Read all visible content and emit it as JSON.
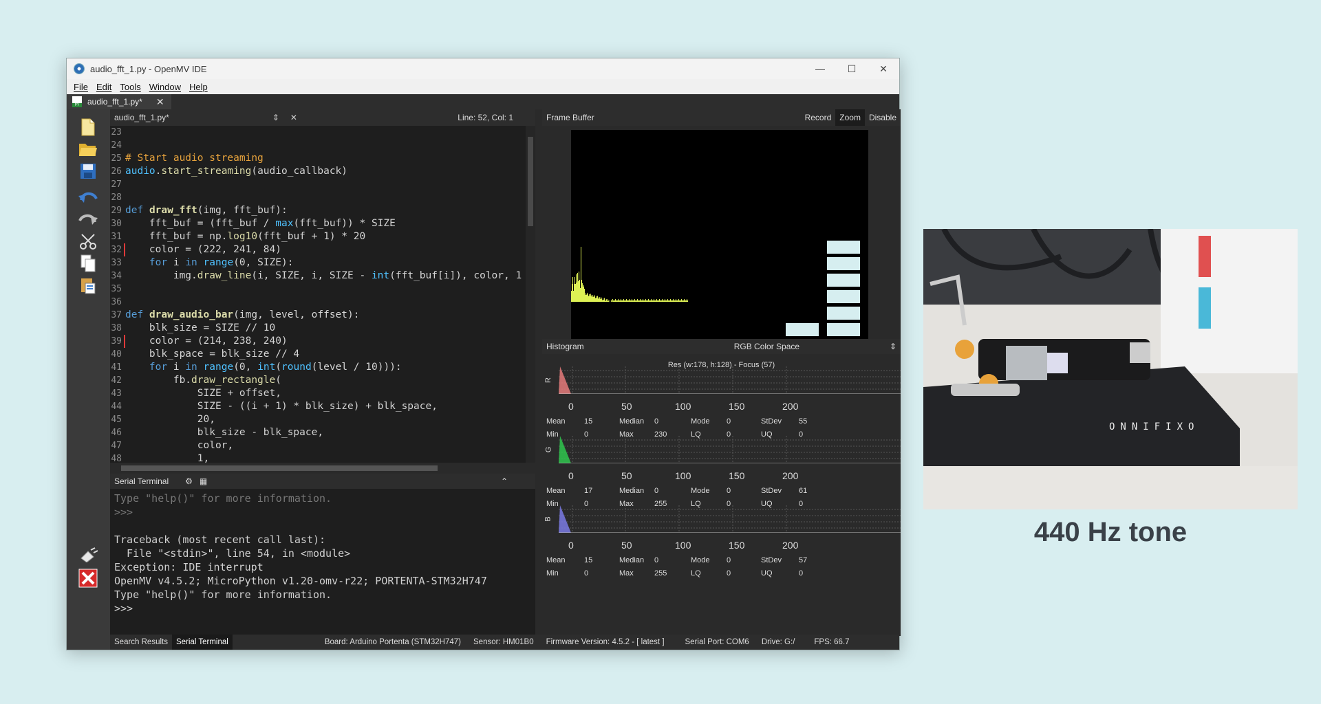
{
  "window": {
    "title": "audio_fft_1.py - OpenMV IDE"
  },
  "menu": [
    "File",
    "Edit",
    "Tools",
    "Window",
    "Help"
  ],
  "file_tab": {
    "label": "audio_fft_1.py*"
  },
  "editor": {
    "file": "audio_fft_1.py*",
    "position": "Line: 52, Col: 1",
    "lines": [
      {
        "n": "23",
        "t": ""
      },
      {
        "n": "24",
        "t": ""
      },
      {
        "n": "25",
        "t": "# Start audio streaming"
      },
      {
        "n": "26",
        "t": "audio.start_streaming(audio_callback)"
      },
      {
        "n": "27",
        "t": ""
      },
      {
        "n": "28",
        "t": ""
      },
      {
        "n": "29",
        "t": "def draw_fft(img, fft_buf):"
      },
      {
        "n": "30",
        "t": "    fft_buf = (fft_buf / max(fft_buf)) * SIZE"
      },
      {
        "n": "31",
        "t": "    fft_buf = np.log10(fft_buf + 1) * 20"
      },
      {
        "n": "32",
        "t": "    color = (222, 241, 84)"
      },
      {
        "n": "33",
        "t": "    for i in range(0, SIZE):"
      },
      {
        "n": "34",
        "t": "        img.draw_line(i, SIZE, i, SIZE - int(fft_buf[i]), color, 1"
      },
      {
        "n": "35",
        "t": ""
      },
      {
        "n": "36",
        "t": ""
      },
      {
        "n": "37",
        "t": "def draw_audio_bar(img, level, offset):"
      },
      {
        "n": "38",
        "t": "    blk_size = SIZE // 10"
      },
      {
        "n": "39",
        "t": "    color = (214, 238, 240)"
      },
      {
        "n": "40",
        "t": "    blk_space = blk_size // 4"
      },
      {
        "n": "41",
        "t": "    for i in range(0, int(round(level / 10))):"
      },
      {
        "n": "42",
        "t": "        fb.draw_rectangle("
      },
      {
        "n": "43",
        "t": "            SIZE + offset,"
      },
      {
        "n": "44",
        "t": "            SIZE - ((i + 1) * blk_size) + blk_space,"
      },
      {
        "n": "45",
        "t": "            20,"
      },
      {
        "n": "46",
        "t": "            blk_size - blk_space,"
      },
      {
        "n": "47",
        "t": "            color,"
      },
      {
        "n": "48",
        "t": "            1,"
      }
    ]
  },
  "terminal": {
    "title": "Serial Terminal",
    "lines": [
      {
        "t": "Type \"help()\" for more information.",
        "dim": true
      },
      {
        "t": ">>>",
        "dim": true
      },
      {
        "t": "",
        "dim": false
      },
      {
        "t": "Traceback (most recent call last):",
        "dim": false
      },
      {
        "t": "  File \"<stdin>\", line 54, in <module>",
        "dim": false
      },
      {
        "t": "Exception: IDE interrupt",
        "dim": false
      },
      {
        "t": "OpenMV v4.5.2; MicroPython v1.20-omv-r22; PORTENTA-STM32H747",
        "dim": false
      },
      {
        "t": "Type \"help()\" for more information.",
        "dim": false
      },
      {
        "t": ">>>",
        "dim": false
      }
    ]
  },
  "status": {
    "search_tab": "Search Results",
    "terminal_tab": "Serial Terminal",
    "board": "Board: Arduino Portenta (STM32H747)",
    "sensor": "Sensor: HM01B0",
    "firmware": "Firmware Version: 4.5.2 - [ latest ]",
    "port": "Serial Port: COM6",
    "drive": "Drive: G:/",
    "fps": "FPS: 66.7"
  },
  "framebuffer": {
    "title": "Frame Buffer",
    "record": "Record",
    "zoom": "Zoom",
    "disable": "Disable",
    "fft_color": "#def154",
    "bar_color": "#d6eef0",
    "level_bars_right": 6,
    "level_bars_left": 1
  },
  "histogram": {
    "title": "Histogram",
    "space": "RGB Color Space",
    "res": "Res (w:178, h:128) - Focus (57)",
    "ticks": [
      "0",
      "50",
      "100",
      "150",
      "200"
    ],
    "channels": [
      {
        "label": "R",
        "color": "#f08080",
        "mean": "15",
        "median": "0",
        "mode": "0",
        "stdev": "55",
        "min": "0",
        "max": "230",
        "lq": "0",
        "uq": "0"
      },
      {
        "label": "G",
        "color": "#30d050",
        "mean": "17",
        "median": "0",
        "mode": "0",
        "stdev": "61",
        "min": "0",
        "max": "255",
        "lq": "0",
        "uq": "0"
      },
      {
        "label": "B",
        "color": "#8080f0",
        "mean": "15",
        "median": "0",
        "mode": "0",
        "stdev": "57",
        "min": "0",
        "max": "255",
        "lq": "0",
        "uq": "0"
      }
    ],
    "labels": {
      "mean": "Mean",
      "median": "Median",
      "mode": "Mode",
      "stdev": "StDev",
      "min": "Min",
      "max": "Max",
      "lq": "LQ",
      "uq": "UQ"
    }
  },
  "caption": "440 Hz tone",
  "photo_text": "ONNIFIXO"
}
